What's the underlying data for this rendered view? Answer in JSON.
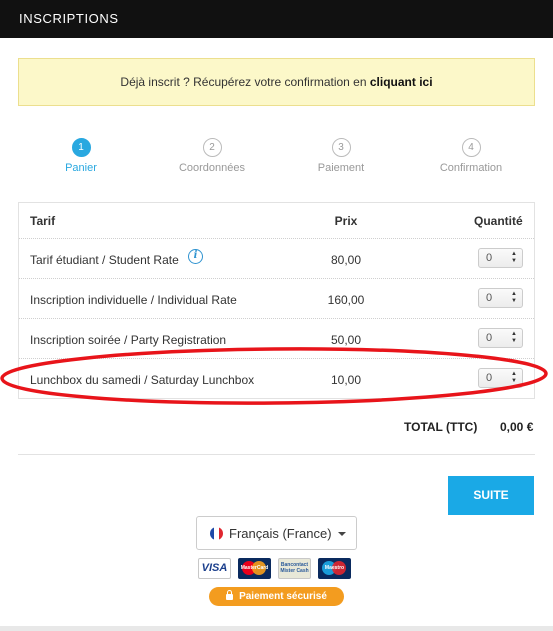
{
  "header": {
    "title": "INSCRIPTIONS"
  },
  "notice": {
    "text": "Déjà inscrit ? Récupérez votre confirmation en ",
    "link": "cliquant ici"
  },
  "steps": [
    {
      "number": "1",
      "label": "Panier"
    },
    {
      "number": "2",
      "label": "Coordonnées"
    },
    {
      "number": "3",
      "label": "Paiement"
    },
    {
      "number": "4",
      "label": "Confirmation"
    }
  ],
  "table": {
    "headers": {
      "tarif": "Tarif",
      "prix": "Prix",
      "quantite": "Quantité"
    },
    "rows": [
      {
        "label": "Tarif étudiant / Student Rate",
        "price": "80,00",
        "qty": "0"
      },
      {
        "label": "Inscription individuelle / Individual Rate",
        "price": "160,00",
        "qty": "0"
      },
      {
        "label": "Inscription soirée / Party Registration",
        "price": "50,00",
        "qty": "0"
      },
      {
        "label": "Lunchbox du samedi / Saturday Lunchbox",
        "price": "10,00",
        "qty": "0"
      }
    ]
  },
  "total": {
    "label": "TOTAL (TTC)",
    "value": "0,00 €"
  },
  "suite_label": "SUITE",
  "language": {
    "selected": "Français (France)"
  },
  "payment_cards": [
    "VISA",
    "MasterCard",
    "Bancontact Mister Cash",
    "Maestro"
  ],
  "secure_label": "Paiement sécurisé",
  "colors": {
    "topbar": "#111111",
    "accent": "#1aa9e6",
    "notice_bg": "#fcf8c9",
    "annotation": "#e8141a",
    "secure_badge": "#f39c1f"
  }
}
